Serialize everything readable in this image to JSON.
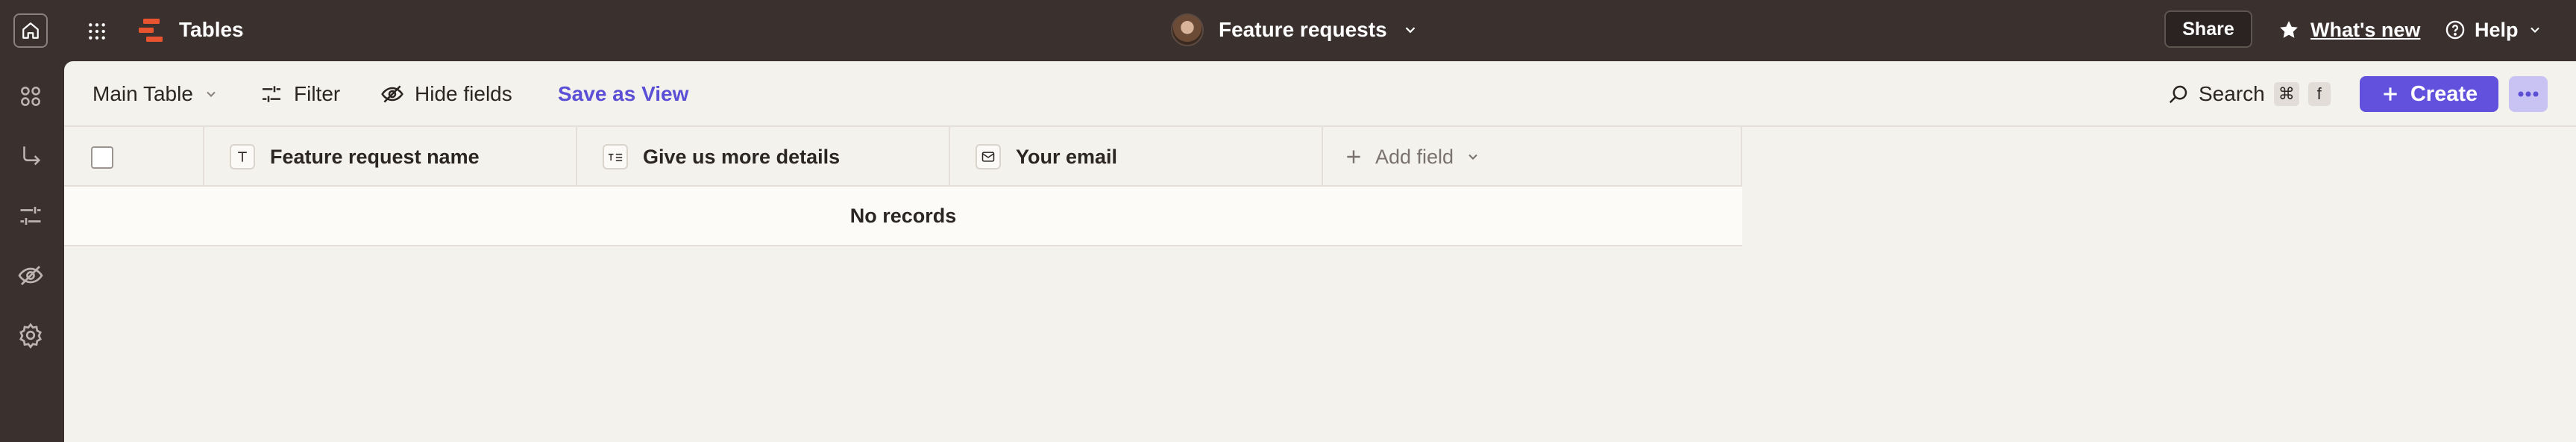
{
  "app": {
    "name": "Tables",
    "brand_color": "#e8542f"
  },
  "header": {
    "doc_title": "Feature requests",
    "share_label": "Share",
    "whats_new_label": "What's new",
    "help_label": "Help"
  },
  "rail": {
    "icons": [
      "apps-icon",
      "branch-arrow-icon",
      "sliders-icon",
      "eye-off-icon",
      "gear-icon"
    ]
  },
  "toolbar": {
    "table_select": "Main Table",
    "filter_label": "Filter",
    "hide_fields_label": "Hide fields",
    "save_view_label": "Save as View",
    "search_label": "Search",
    "shortcut_keys": [
      "⌘",
      "f"
    ],
    "create_label": "Create",
    "accent": "#6251dc"
  },
  "table": {
    "columns": [
      {
        "label": "Feature request name",
        "icon": "text-icon"
      },
      {
        "label": "Give us more details",
        "icon": "long-text-icon"
      },
      {
        "label": "Your email",
        "icon": "email-icon"
      }
    ],
    "add_field_label": "Add field",
    "empty_message": "No records"
  }
}
